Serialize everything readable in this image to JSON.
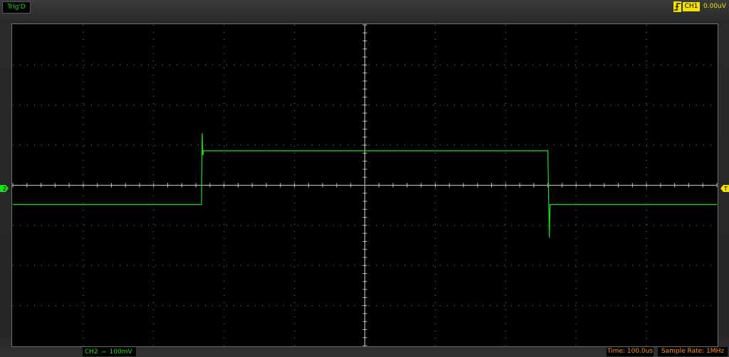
{
  "top": {
    "trig_status": "Trig'D",
    "trigger_channel": "CH1",
    "trigger_level": "0.00uV",
    "trigger_edge_icon": "rising-edge-icon"
  },
  "markers": {
    "channel_marker": "2",
    "trigger_time_marker": "T"
  },
  "bottom": {
    "channel": "CH2",
    "coupling_icon": "dc-coupling-icon",
    "coupling_symbol": "⎓",
    "volts_per_div": "100mV",
    "timebase": "Time: 100.0us",
    "sample_rate": "Sample Rate: 1MHz"
  },
  "colors": {
    "trace": "#19e019",
    "trigger": "#f2e000",
    "timebase_text": "#ff8c1a",
    "screen_bg": "#000000",
    "grid": "#8a8a8a"
  },
  "chart_data": {
    "type": "line",
    "title": "",
    "xlabel": "",
    "ylabel": "",
    "x_divisions": 10,
    "y_divisions": 8,
    "x_unit": "us",
    "x_per_div": 100,
    "y_unit": "mV",
    "y_per_div": 100,
    "xlim": [
      -500,
      500
    ],
    "ylim": [
      -400,
      400
    ],
    "grid": true,
    "series": [
      {
        "x": [
          -500,
          -240,
          -232,
          -231,
          -230,
          -229,
          0,
          258,
          260,
          262,
          263,
          266,
          500
        ],
        "y": [
          -48,
          -48,
          -48,
          130,
          75,
          86,
          86,
          86,
          86,
          -130,
          -48,
          -48,
          -48
        ]
      }
    ]
  }
}
